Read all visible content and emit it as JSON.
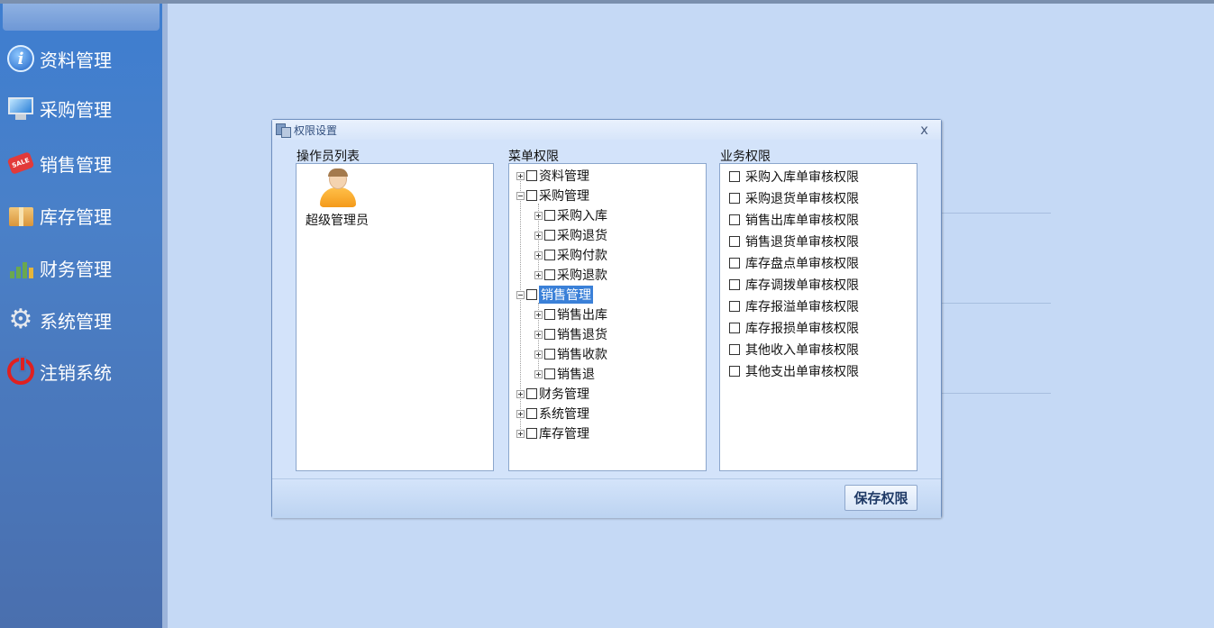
{
  "sidebar": {
    "items": [
      {
        "label": "资料管理",
        "icon": "info-icon"
      },
      {
        "label": "采购管理",
        "icon": "monitor-icon"
      },
      {
        "label": "销售管理",
        "icon": "sale-tag-icon"
      },
      {
        "label": "库存管理",
        "icon": "box-icon"
      },
      {
        "label": "财务管理",
        "icon": "chart-icon"
      },
      {
        "label": "系统管理",
        "icon": "gear-icon"
      },
      {
        "label": "注销系统",
        "icon": "power-icon"
      }
    ],
    "sale_badge": "SALE"
  },
  "dialog": {
    "title": "权限设置",
    "close": "x",
    "operators_label": "操作员列表",
    "operators": [
      {
        "name": "超级管理员"
      }
    ],
    "menu_label": "菜单权限",
    "menu_tree": [
      {
        "label": "资料管理",
        "expanded": false
      },
      {
        "label": "采购管理",
        "expanded": true,
        "children": [
          {
            "label": "采购入库"
          },
          {
            "label": "采购退货"
          },
          {
            "label": "采购付款"
          },
          {
            "label": "采购退款"
          }
        ]
      },
      {
        "label": "销售管理",
        "expanded": true,
        "selected": true,
        "children": [
          {
            "label": "销售出库"
          },
          {
            "label": "销售退货"
          },
          {
            "label": "销售收款"
          },
          {
            "label": "销售退"
          }
        ]
      },
      {
        "label": "财务管理",
        "expanded": false
      },
      {
        "label": "系统管理",
        "expanded": false
      },
      {
        "label": "库存管理",
        "expanded": false
      }
    ],
    "business_label": "业务权限",
    "business": [
      "采购入库单审核权限",
      "采购退货单审核权限",
      "销售出库单审核权限",
      "销售退货单审核权限",
      "库存盘点单审核权限",
      "库存调拨单审核权限",
      "库存报溢单审核权限",
      "库存报损单审核权限",
      "其他收入单审核权限",
      "其他支出单审核权限"
    ],
    "save_label": "保存权限"
  }
}
